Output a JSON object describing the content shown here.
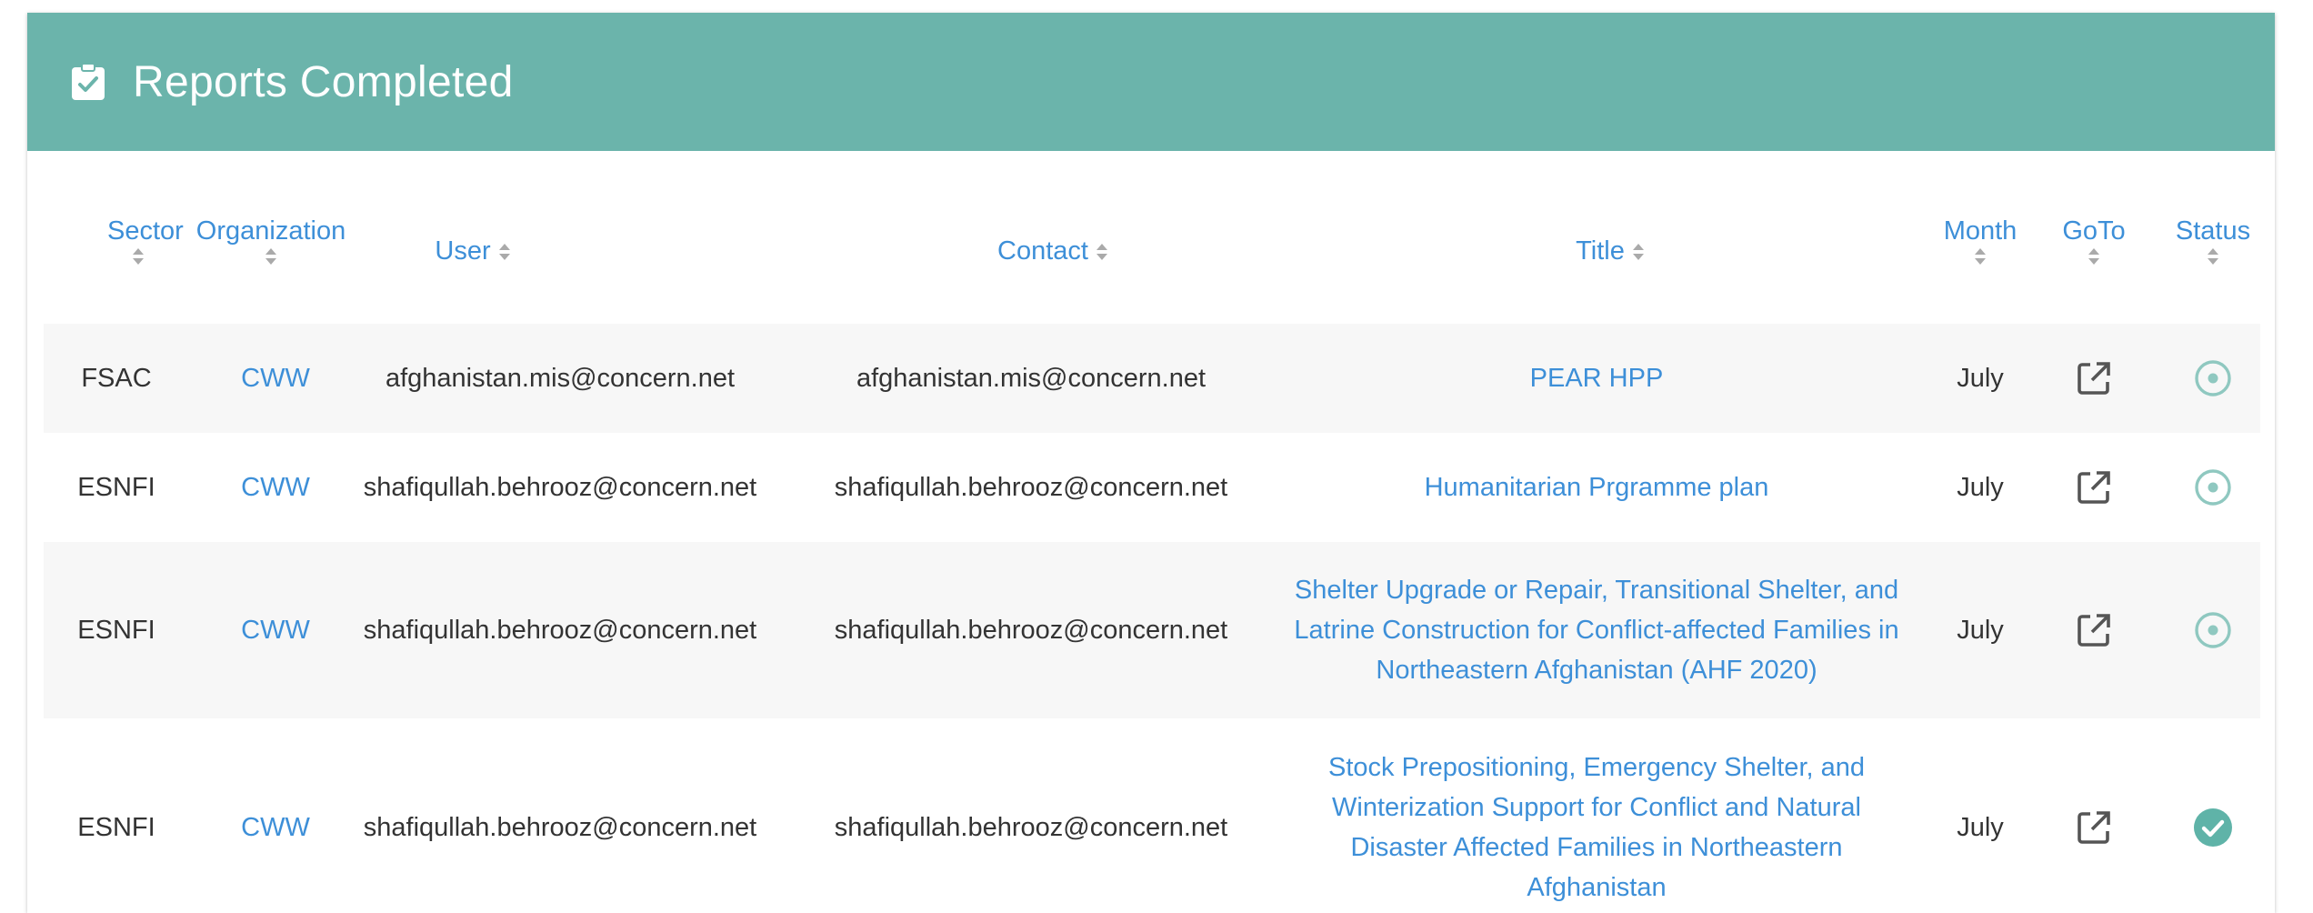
{
  "card": {
    "title": "Reports Completed",
    "header_icon": "clipboard-check-icon",
    "header_color": "#6bb4ab"
  },
  "columns": {
    "sector": "Sector",
    "organization": "Organization",
    "user": "User",
    "contact": "Contact",
    "title": "Title",
    "month": "Month",
    "goto": "GoTo",
    "status": "Status"
  },
  "rows": [
    {
      "sector": "FSAC",
      "organization": "CWW",
      "user": "afghanistan.mis@concern.net",
      "contact": "afghanistan.mis@concern.net",
      "title": "PEAR HPP",
      "month": "July",
      "goto_icon": "open-in-new-icon",
      "status": "pending",
      "status_icon": "radio-dot-icon"
    },
    {
      "sector": "ESNFI",
      "organization": "CWW",
      "user": "shafiqullah.behrooz@concern.net",
      "contact": "shafiqullah.behrooz@concern.net",
      "title": "Humanitarian Prgramme plan",
      "month": "July",
      "goto_icon": "open-in-new-icon",
      "status": "pending",
      "status_icon": "radio-dot-icon"
    },
    {
      "sector": "ESNFI",
      "organization": "CWW",
      "user": "shafiqullah.behrooz@concern.net",
      "contact": "shafiqullah.behrooz@concern.net",
      "title": "Shelter Upgrade or Repair, Transitional Shelter, and Latrine Construction for Conflict-affected Families in Northeastern Afghanistan (AHF 2020)",
      "month": "July",
      "goto_icon": "open-in-new-icon",
      "status": "pending",
      "status_icon": "radio-dot-icon"
    },
    {
      "sector": "ESNFI",
      "organization": "CWW",
      "user": "shafiqullah.behrooz@concern.net",
      "contact": "shafiqullah.behrooz@concern.net",
      "title": "Stock Prepositioning, Emergency Shelter, and Winterization Support for Conflict and Natural Disaster Affected Families in Northeastern Afghanistan",
      "month": "July",
      "goto_icon": "open-in-new-icon",
      "status": "complete",
      "status_icon": "check-circle-icon"
    }
  ],
  "colors": {
    "link": "#3d8fd8",
    "status_teal": "#8fc8c0",
    "status_complete": "#5fb3a8",
    "row_stripe": "#f7f7f7"
  }
}
